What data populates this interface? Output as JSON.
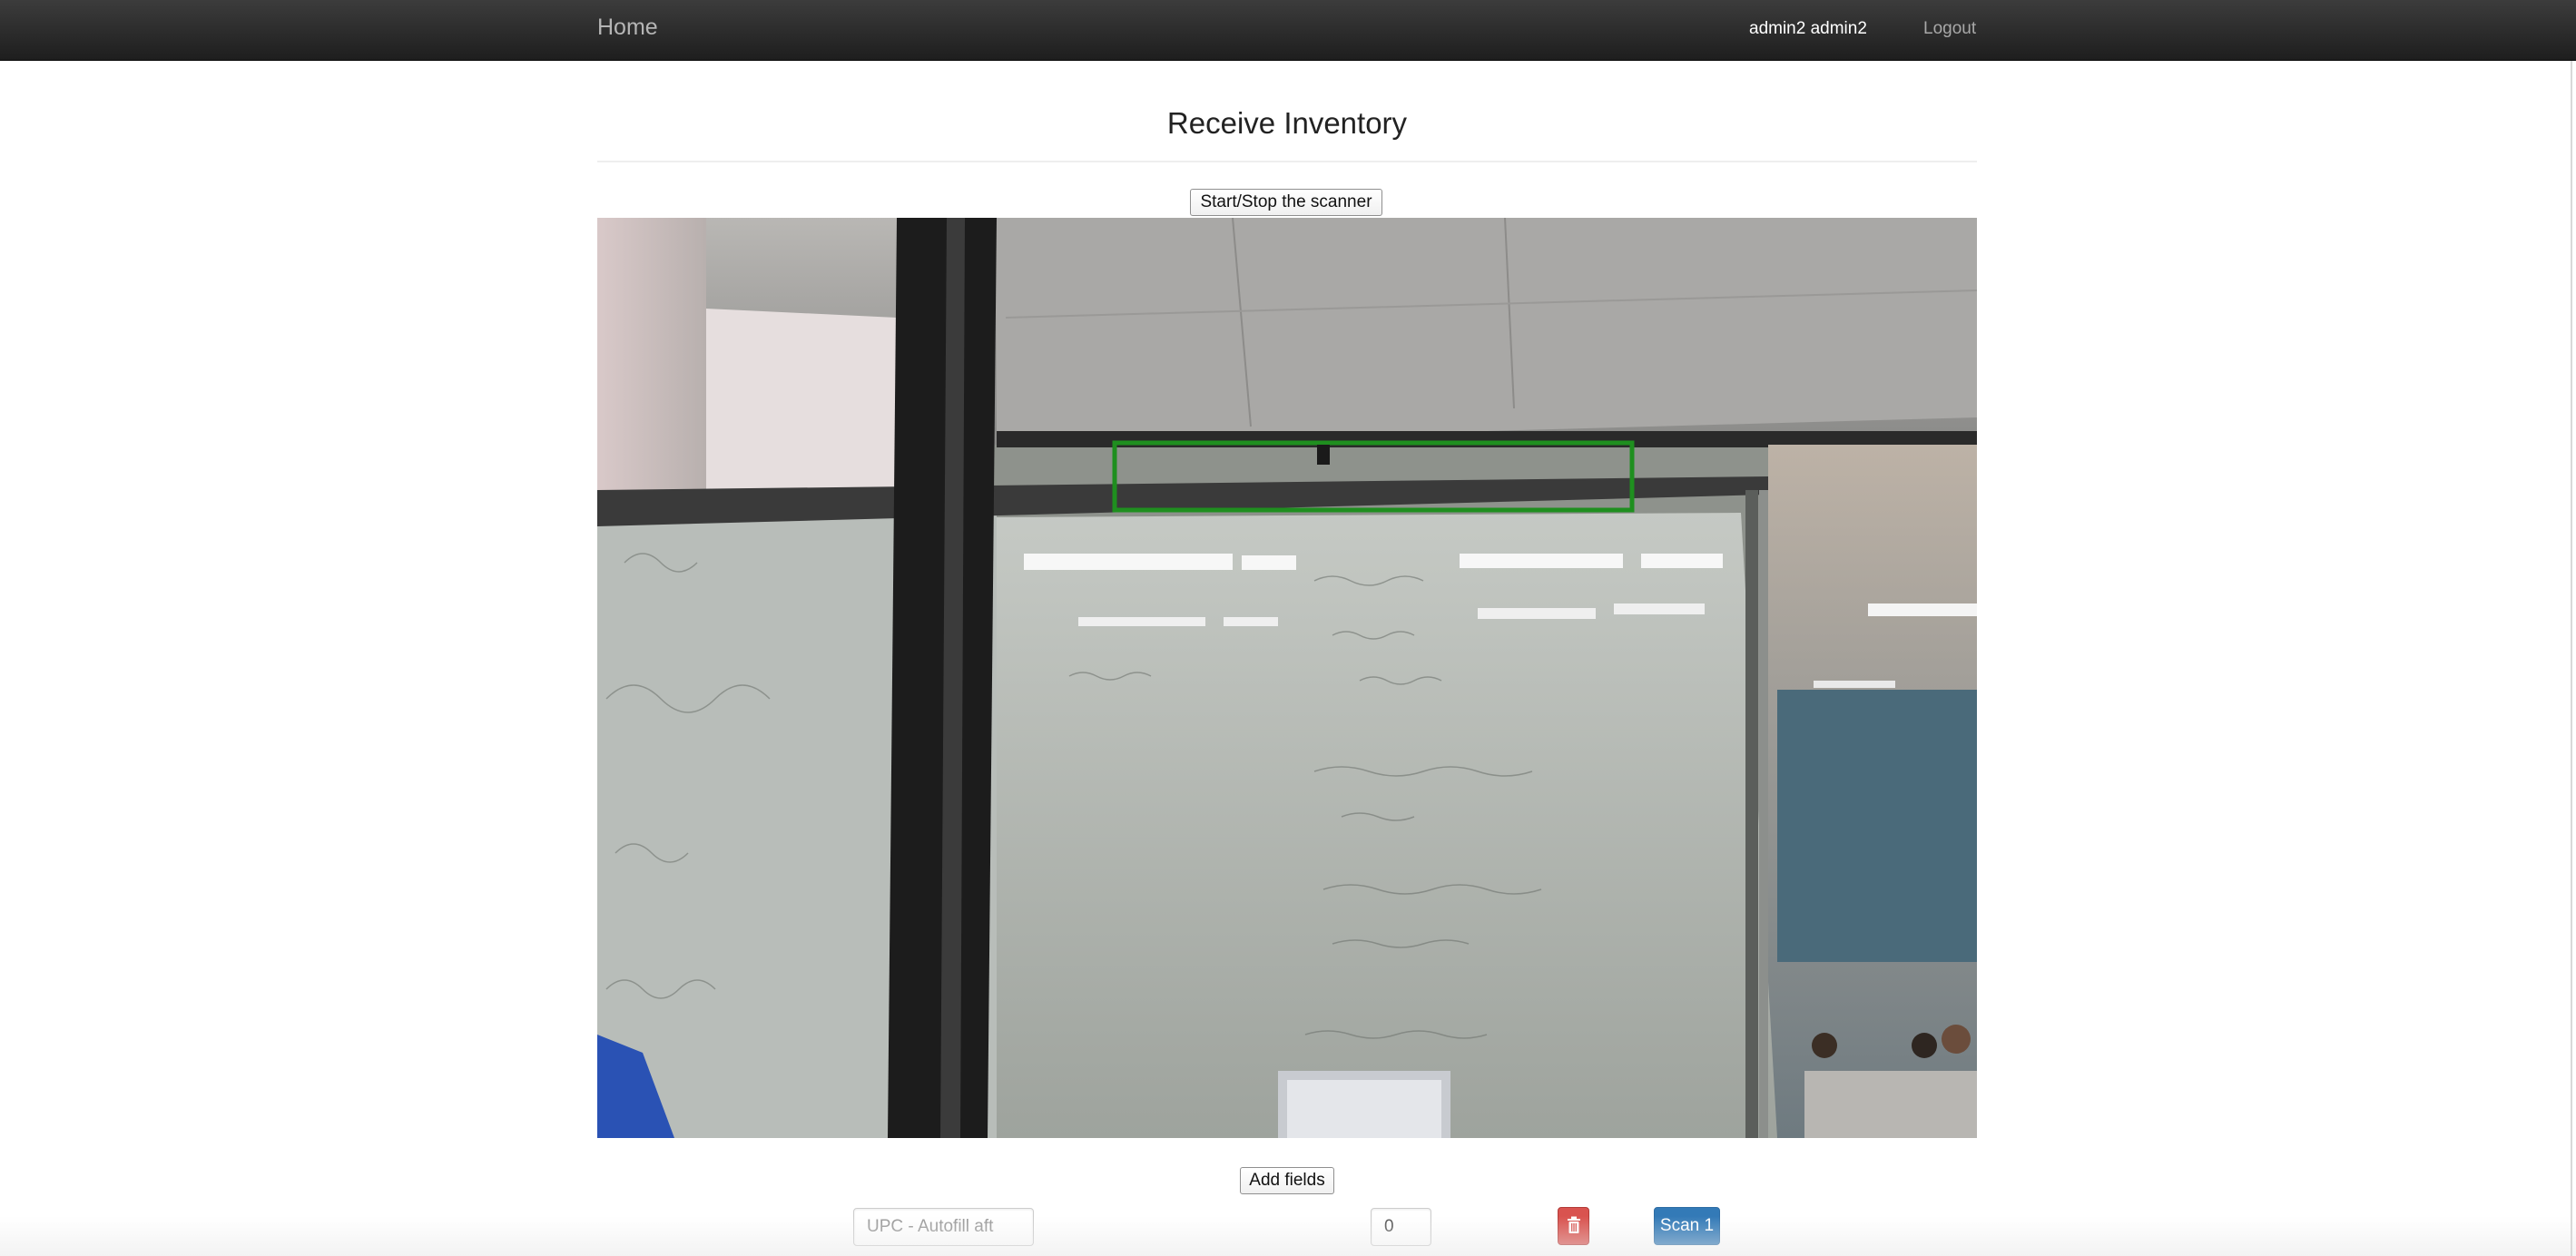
{
  "navbar": {
    "brand_label": "Home",
    "user_label": "admin2 admin2",
    "logout_label": "Logout"
  },
  "page": {
    "title": "Receive Inventory"
  },
  "scanner": {
    "toggle_label": "Start/Stop the scanner"
  },
  "fields": {
    "add_label": "Add fields",
    "rows": [
      {
        "upc_placeholder": "UPC - Autofill aft",
        "upc_value": "",
        "quantity_value": "0",
        "delete_icon": "trash-icon",
        "scan_label": "Scan 1"
      }
    ]
  },
  "colors": {
    "navbar": "#222222",
    "danger": "#d9534f",
    "primary": "#337ab7",
    "detection_box": "#1f8f1f"
  }
}
